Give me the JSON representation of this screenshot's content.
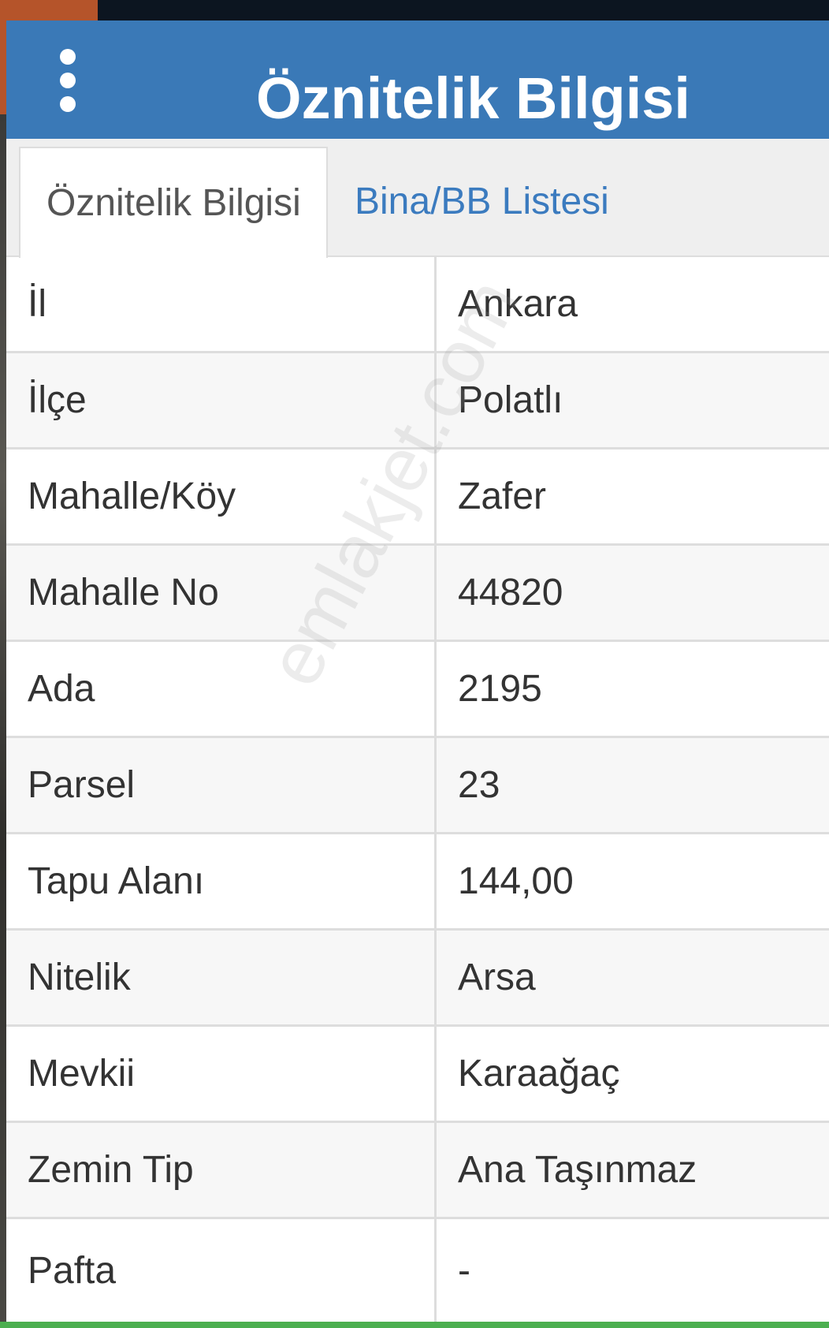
{
  "header": {
    "title": "Öznitelik Bilgisi"
  },
  "tabs": [
    {
      "label": "Öznitelik Bilgisi",
      "active": true
    },
    {
      "label": "Bina/BB Listesi",
      "active": false
    }
  ],
  "attributes": [
    {
      "label": "İl",
      "value": "Ankara"
    },
    {
      "label": "İlçe",
      "value": "Polatlı"
    },
    {
      "label": "Mahalle/Köy",
      "value": "Zafer"
    },
    {
      "label": "Mahalle No",
      "value": "44820"
    },
    {
      "label": "Ada",
      "value": "2195"
    },
    {
      "label": "Parsel",
      "value": "23"
    },
    {
      "label": "Tapu Alanı",
      "value": "144,00"
    },
    {
      "label": "Nitelik",
      "value": "Arsa"
    },
    {
      "label": "Mevkii",
      "value": "Karaağaç"
    },
    {
      "label": "Zemin Tip",
      "value": "Ana Taşınmaz"
    },
    {
      "label": "Pafta",
      "value": "-"
    }
  ],
  "watermark": "emlakjet.com",
  "colors": {
    "header": "#3a79b7",
    "tab_link": "#3b7bbf",
    "text": "#333333"
  },
  "icons": {
    "menu": "more-vertical-icon"
  }
}
